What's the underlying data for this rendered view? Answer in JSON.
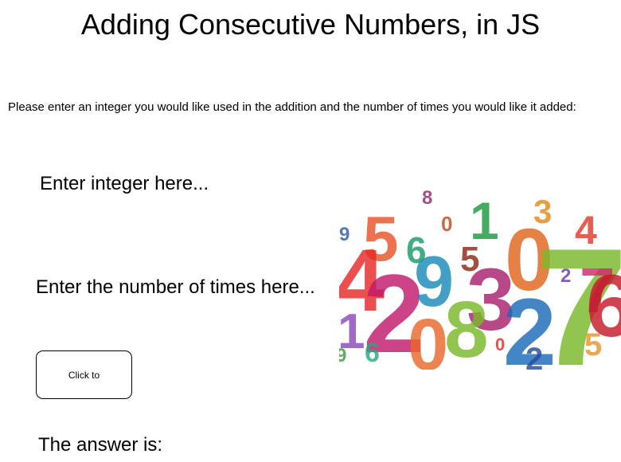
{
  "title": "Adding Consecutive Numbers, in JS",
  "instructions": "Please enter an integer you would like used in the addition and the number of times you would like it added:",
  "form": {
    "integer_placeholder": "Enter integer here...",
    "times_placeholder": "Enter the number of times here...",
    "submit_label": "Click to"
  },
  "answer_label": "The answer is:",
  "image": {
    "digits": [
      "8",
      "1",
      "3",
      "0",
      "4",
      "9",
      "5",
      "6",
      "4",
      "5",
      "0",
      "2",
      "9",
      "3",
      "7",
      "2",
      "7",
      "6",
      "1",
      "2",
      "0",
      "8",
      "2",
      "9",
      "6",
      "0",
      "5"
    ]
  }
}
